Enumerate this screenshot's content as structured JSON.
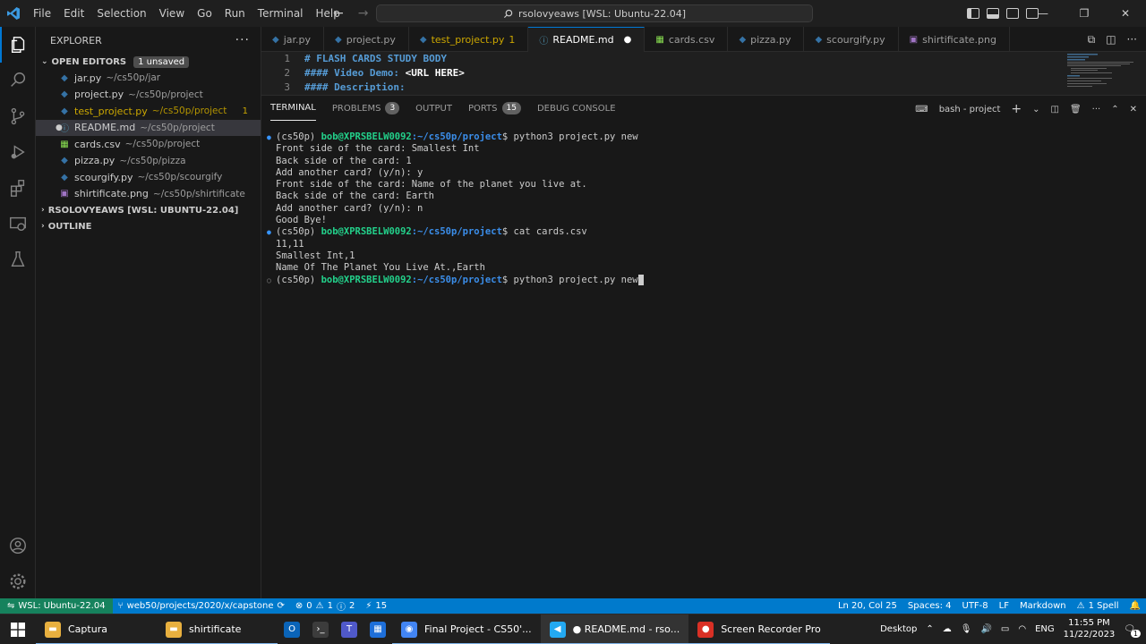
{
  "titlebar": {
    "menu": [
      "File",
      "Edit",
      "Selection",
      "View",
      "Go",
      "Run",
      "Terminal",
      "Help"
    ],
    "search": "rsolovyeaws [WSL: Ubuntu-22.04]"
  },
  "sidebar": {
    "title": "EXPLORER",
    "open_editors": {
      "label": "OPEN EDITORS",
      "badge": "1 unsaved",
      "items": [
        {
          "name": "jar.py",
          "path": "~/cs50p/jar",
          "icon": "python",
          "color": "#3572a5"
        },
        {
          "name": "project.py",
          "path": "~/cs50p/project",
          "icon": "python",
          "color": "#3572a5"
        },
        {
          "name": "test_project.py",
          "path": "~/cs50p/project",
          "icon": "python",
          "problems": "1",
          "warning": true
        },
        {
          "name": "README.md",
          "path": "~/cs50p/project",
          "icon": "info",
          "modified": true,
          "selected": true
        },
        {
          "name": "cards.csv",
          "path": "~/cs50p/project",
          "icon": "csv"
        },
        {
          "name": "pizza.py",
          "path": "~/cs50p/pizza",
          "icon": "python"
        },
        {
          "name": "scourgify.py",
          "path": "~/cs50p/scourgify",
          "icon": "python"
        },
        {
          "name": "shirtificate.png",
          "path": "~/cs50p/shirtificate",
          "icon": "image"
        }
      ]
    },
    "workspace": "RSOLOVYEAWS [WSL: UBUNTU-22.04]",
    "outline": "OUTLINE"
  },
  "tabs": [
    {
      "label": "jar.py",
      "icon": "python"
    },
    {
      "label": "project.py",
      "icon": "python"
    },
    {
      "label": "test_project.py",
      "suffix": "1",
      "icon": "python",
      "warning": true
    },
    {
      "label": "README.md",
      "icon": "info",
      "active": true,
      "modified": true
    },
    {
      "label": "cards.csv",
      "icon": "csv"
    },
    {
      "label": "pizza.py",
      "icon": "python"
    },
    {
      "label": "scourgify.py",
      "icon": "python"
    },
    {
      "label": "shirtificate.png",
      "icon": "image"
    }
  ],
  "editor": {
    "lines": [
      {
        "num": "1",
        "text": "# FLASH CARDS STUDY BODY"
      },
      {
        "num": "2",
        "text": "#### Video Demo:  ",
        "extra": "<URL HERE>"
      },
      {
        "num": "3",
        "text": "#### Description:"
      }
    ]
  },
  "panel": {
    "tabs": [
      {
        "label": "TERMINAL",
        "active": true
      },
      {
        "label": "PROBLEMS",
        "badge": "3"
      },
      {
        "label": "OUTPUT"
      },
      {
        "label": "PORTS",
        "badge": "15"
      },
      {
        "label": "DEBUG CONSOLE"
      }
    ],
    "terminal_name": "bash - project"
  },
  "terminal": {
    "env": "(cs50p)",
    "user": "bob@XPRSBELW0092",
    "path": ":~/cs50p/project",
    "prompt_char": "$",
    "lines": [
      {
        "type": "cmd",
        "text": " python3 project.py new",
        "marker": "●"
      },
      {
        "type": "out",
        "text": "Front side of the card: Smallest Int"
      },
      {
        "type": "out",
        "text": "Back side of the card: 1"
      },
      {
        "type": "out",
        "text": "Add another card? (y/n): y"
      },
      {
        "type": "out",
        "text": "Front side of the card: Name of the planet you live at."
      },
      {
        "type": "out",
        "text": "Back side of the card: Earth"
      },
      {
        "type": "out",
        "text": "Add another card? (y/n): n"
      },
      {
        "type": "out",
        "text": "Good Bye!"
      },
      {
        "type": "cmd",
        "text": " cat cards.csv",
        "marker": "●"
      },
      {
        "type": "out",
        "text": "11,11"
      },
      {
        "type": "out",
        "text": "Smallest Int,1"
      },
      {
        "type": "out",
        "text": "Name Of The Planet You Live At.,Earth"
      },
      {
        "type": "cmd",
        "text": " python3 project.py new",
        "marker": "○",
        "cursor": true
      }
    ]
  },
  "statusbar": {
    "remote": "WSL: Ubuntu-22.04",
    "branch": "web50/projects/2020/x/capstone",
    "errors": "0",
    "warnings": "1",
    "info": "2",
    "ports": "15",
    "position": "Ln 20, Col 25",
    "spaces": "Spaces: 4",
    "encoding": "UTF-8",
    "eol": "LF",
    "language": "Markdown",
    "spell": "1 Spell"
  },
  "taskbar": {
    "items": [
      {
        "label": "Captura",
        "icon": "folder"
      },
      {
        "label": "shirtificate",
        "icon": "folder"
      },
      {
        "label": "",
        "icon": "outlook"
      },
      {
        "label": "",
        "icon": "terminal"
      },
      {
        "label": "",
        "icon": "teams"
      },
      {
        "label": "",
        "icon": "store"
      },
      {
        "label": "Final Project - CS50'...",
        "icon": "chrome"
      },
      {
        "label": "● README.md - rso...",
        "icon": "vscode",
        "active": true
      },
      {
        "label": "Screen Recorder Pro",
        "icon": "recorder"
      }
    ],
    "desktop": "Desktop",
    "lang": "ENG",
    "time": "11:55 PM",
    "date": "11/22/2023",
    "notif": "1"
  }
}
